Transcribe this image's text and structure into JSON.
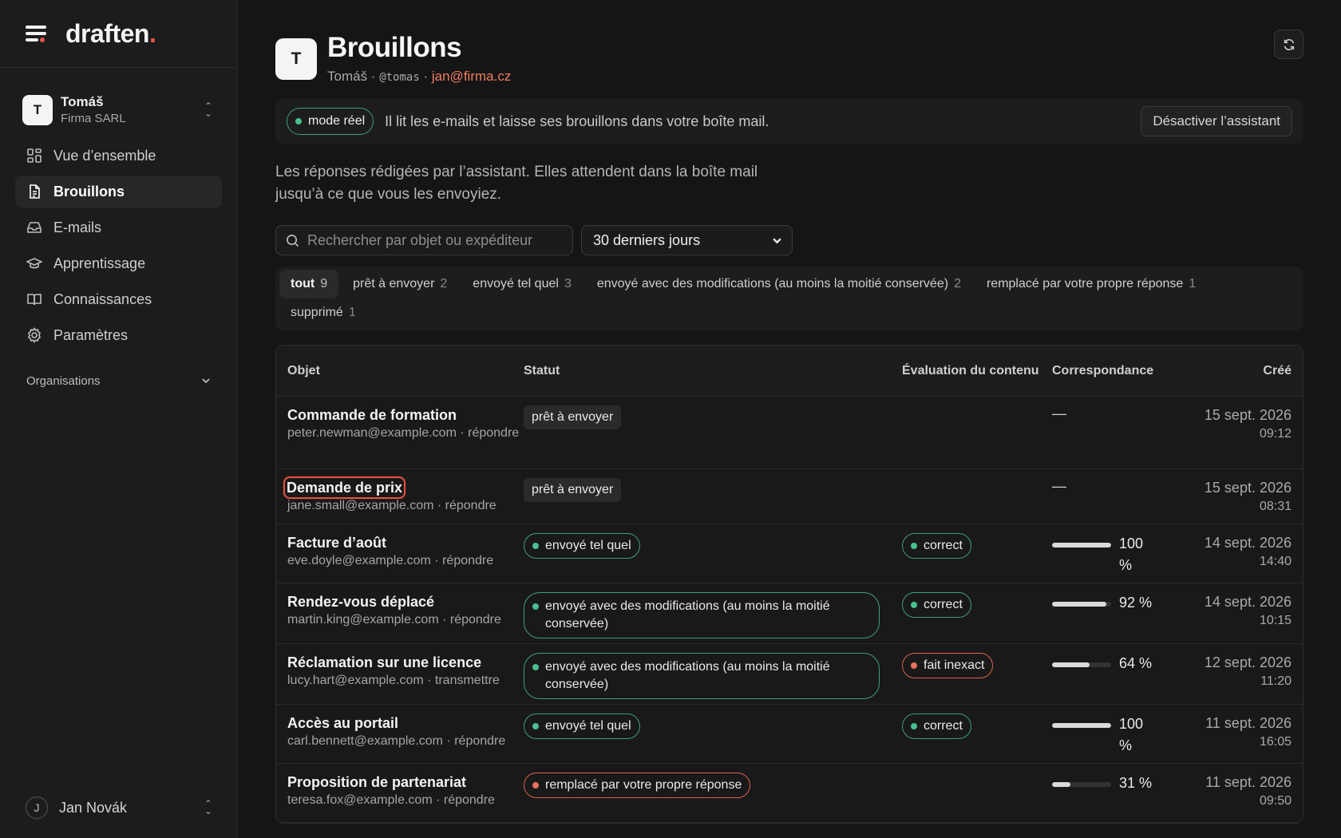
{
  "brand": {
    "name": "draften",
    "dot": "."
  },
  "account": {
    "initial": "T",
    "name": "Tomáš",
    "org": "Firma SARL"
  },
  "nav": [
    {
      "label": "Vue d’ensemble",
      "icon": "grid-icon",
      "active": false
    },
    {
      "label": "Brouillons",
      "icon": "document-icon",
      "active": true
    },
    {
      "label": "E-mails",
      "icon": "inbox-icon",
      "active": false
    },
    {
      "label": "Apprentissage",
      "icon": "graduation-cap-icon",
      "active": false
    },
    {
      "label": "Connaissances",
      "icon": "book-icon",
      "active": false
    },
    {
      "label": "Paramètres",
      "icon": "gear-icon",
      "active": false
    }
  ],
  "organisations_label": "Organisations",
  "user": {
    "initial": "J",
    "name": "Jan Novák"
  },
  "header": {
    "initial": "T",
    "title": "Brouillons",
    "name": "Tomáš",
    "sep1": " · ",
    "handle": "@tomas",
    "sep2": " · ",
    "email": "jan@firma.cz"
  },
  "banner": {
    "mode": "mode réel",
    "text": "Il lit les e-mails et laisse ses brouillons dans votre boîte mail.",
    "button": "Désactiver l’assistant"
  },
  "intro": "Les réponses rédigées par l’assistant. Elles attendent dans la boîte mail jusqu’à ce que vous les envoyiez.",
  "search": {
    "placeholder": "Rechercher par objet ou expéditeur"
  },
  "period": {
    "selected": "30 derniers jours"
  },
  "tabs": [
    {
      "label": "tout",
      "count": "9",
      "active": true
    },
    {
      "label": "prêt à envoyer",
      "count": "2"
    },
    {
      "label": "envoyé tel quel",
      "count": "3"
    },
    {
      "label": "envoyé avec des modifications (au moins la moitié conservée)",
      "count": "2"
    },
    {
      "label": "remplacé par votre propre réponse",
      "count": "1"
    },
    {
      "label": "supprimé",
      "count": "1"
    }
  ],
  "table": {
    "headers": {
      "subject": "Objet",
      "status": "Statut",
      "evaluation": "Évaluation du contenu",
      "match": "Correspondance",
      "created": "Créé"
    },
    "rows": [
      {
        "subject": "Commande de formation",
        "sender": "peter.newman@example.com · répondre",
        "status": "prêt à envoyer",
        "status_style": "plain",
        "evaluation": "",
        "match": "—",
        "match_value": null,
        "date": "15 sept. 2026",
        "time": "09:12"
      },
      {
        "subject": "Demande de prix",
        "sender": "jane.small@example.com · répondre",
        "status": "prêt à envoyer",
        "status_style": "plain",
        "evaluation": "",
        "match": "—",
        "match_value": null,
        "date": "15 sept. 2026",
        "time": "08:31",
        "selected": true
      },
      {
        "subject": "Facture d’août",
        "sender": "eve.doyle@example.com · répondre",
        "status": "envoyé tel quel",
        "status_style": "green",
        "evaluation": "correct",
        "eval_style": "green",
        "match": "100 %",
        "match_value": 100,
        "date": "14 sept. 2026",
        "time": "14:40"
      },
      {
        "subject": "Rendez-vous déplacé",
        "sender": "martin.king@example.com · répondre",
        "status": "envoyé avec des modifications (au moins la moitié conservée)",
        "status_style": "green-wide",
        "evaluation": "correct",
        "eval_style": "green",
        "match": "92 %",
        "match_value": 92,
        "date": "14 sept. 2026",
        "time": "10:15"
      },
      {
        "subject": "Réclamation sur une licence",
        "sender": "lucy.hart@example.com · transmettre",
        "status": "envoyé avec des modifications (au moins la moitié conservée)",
        "status_style": "green-wide",
        "evaluation": "fait inexact",
        "eval_style": "red",
        "match": "64 %",
        "match_value": 64,
        "date": "12 sept. 2026",
        "time": "11:20"
      },
      {
        "subject": "Accès au portail",
        "sender": "carl.bennett@example.com · répondre",
        "status": "envoyé tel quel",
        "status_style": "green",
        "evaluation": "correct",
        "eval_style": "green",
        "match": "100 %",
        "match_value": 100,
        "date": "11 sept. 2026",
        "time": "16:05"
      },
      {
        "subject": "Proposition de partenariat",
        "sender": "teresa.fox@example.com · répondre",
        "status": "remplacé par votre propre réponse",
        "status_style": "red",
        "evaluation": "",
        "match": "31 %",
        "match_value": 31,
        "date": "11 sept. 2026",
        "time": "09:50"
      }
    ]
  },
  "colors": {
    "accent": "#e8574a",
    "green": "#49c08f",
    "red": "#e8705c",
    "email": "#ef7d62"
  }
}
